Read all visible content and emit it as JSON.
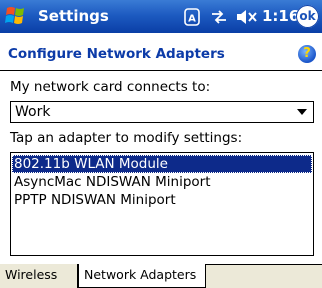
{
  "titlebar": {
    "title": "Settings",
    "time": "1:16",
    "ok_label": "ok",
    "icons": [
      "start-flag-icon",
      "dialer-icon",
      "connectivity-icon",
      "volume-icon"
    ]
  },
  "header": {
    "title": "Configure Network Adapters",
    "help_icon": "help-icon",
    "help_glyph": "?"
  },
  "form": {
    "connects_label": "My network card connects to:",
    "connects_value": "Work",
    "adapters_label": "Tap an adapter to modify settings:",
    "adapters": [
      {
        "label": "802.11b WLAN Module",
        "selected": true
      },
      {
        "label": "AsyncMac NDISWAN Miniport",
        "selected": false
      },
      {
        "label": "PPTP NDISWAN Miniport",
        "selected": false
      }
    ]
  },
  "tabs": [
    {
      "label": "Wireless",
      "active": false
    },
    {
      "label": "Network Adapters",
      "active": true
    }
  ],
  "colors": {
    "titlebar": "#1d5bc1",
    "heading": "#0c3ba8",
    "selection": "#0d2a8a"
  }
}
